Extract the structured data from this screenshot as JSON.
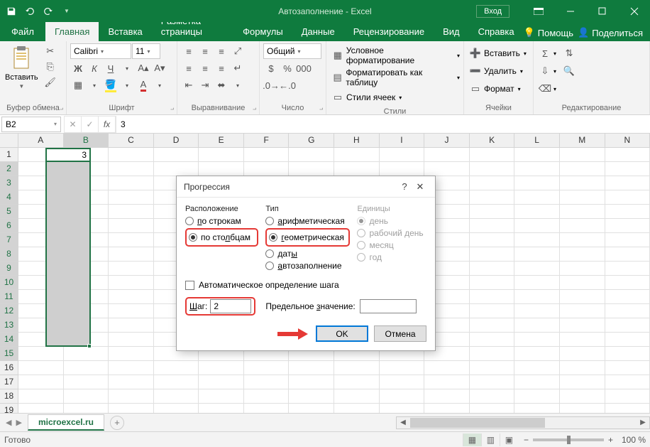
{
  "titlebar": {
    "title": "Автозаполнение  -  Excel",
    "signin": "Вход"
  },
  "tabs": {
    "file": "Файл",
    "home": "Главная",
    "insert": "Вставка",
    "layout": "Разметка страницы",
    "formulas": "Формулы",
    "data": "Данные",
    "review": "Рецензирование",
    "view": "Вид",
    "help": "Справка",
    "assist": "Помощь",
    "share": "Поделиться"
  },
  "ribbon": {
    "clipboard": {
      "label": "Буфер обмена",
      "paste": "Вставить"
    },
    "font": {
      "label": "Шрифт",
      "name": "Calibri",
      "size": "11"
    },
    "align": {
      "label": "Выравнивание"
    },
    "number": {
      "label": "Число",
      "format": "Общий"
    },
    "styles": {
      "label": "Стили",
      "cond": "Условное форматирование",
      "table": "Форматировать как таблицу",
      "cell": "Стили ячеек"
    },
    "cells": {
      "label": "Ячейки",
      "insert": "Вставить",
      "delete": "Удалить",
      "format": "Формат"
    },
    "editing": {
      "label": "Редактирование"
    }
  },
  "fbar": {
    "name": "B2",
    "value": "3"
  },
  "grid": {
    "cols": [
      "A",
      "B",
      "C",
      "D",
      "E",
      "F",
      "G",
      "H",
      "I",
      "J",
      "K",
      "L",
      "M",
      "N"
    ],
    "active_value": "3"
  },
  "dialog": {
    "title": "Прогрессия",
    "g_arrange": "Расположение",
    "rows": "по строкам",
    "cols": "по столбцам",
    "g_type": "Тип",
    "arith": "арифметическая",
    "geom": "геометрическая",
    "dates": "даты",
    "auto": "автозаполнение",
    "g_units": "Единицы",
    "day": "день",
    "workday": "рабочий день",
    "month": "месяц",
    "year": "год",
    "autostep": "Автоматическое определение шага",
    "step_lbl": "Шаг:",
    "step_val": "2",
    "limit_lbl": "Предельное значение:",
    "limit_val": "",
    "ok": "OK",
    "cancel": "Отмена"
  },
  "sheet": {
    "tab": "microexcel.ru"
  },
  "status": {
    "ready": "Готово",
    "zoom": "100 %"
  }
}
